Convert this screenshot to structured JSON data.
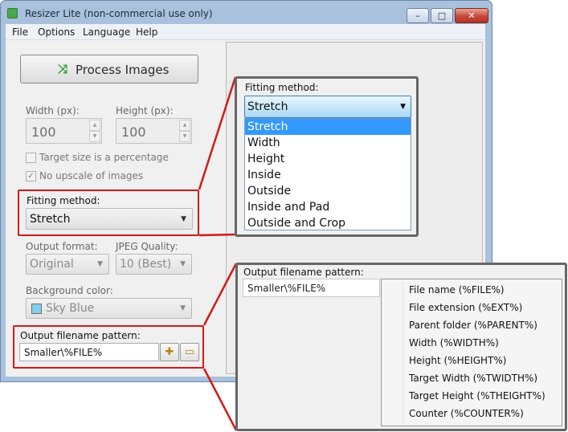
{
  "window": {
    "title": "Resizer Lite (non-commercial use only)",
    "minimize_glyph": "–",
    "maximize_glyph": "□",
    "close_glyph": "✕"
  },
  "menu": [
    "File",
    "Options",
    "Language",
    "Help"
  ],
  "process_button": {
    "label": "Process Images",
    "icon": "process-arrows-icon"
  },
  "width": {
    "label": "Width (px):",
    "value": "100"
  },
  "height": {
    "label": "Height (px):",
    "value": "100"
  },
  "checks": {
    "percentage": {
      "label": "Target size is a percentage",
      "checked": false
    },
    "no_upscale": {
      "label": "No upscale of images",
      "checked": true
    }
  },
  "fitting": {
    "label": "Fitting method:",
    "value": "Stretch"
  },
  "output_format": {
    "label": "Output format:",
    "value": "Original"
  },
  "jpeg_quality": {
    "label": "JPEG Quality:",
    "value": "10 (Best)"
  },
  "background": {
    "label": "Background color:",
    "value": "Sky Blue",
    "swatch_color": "#87ceeb"
  },
  "filename": {
    "label": "Output filename pattern:",
    "value": "Smaller\\%FILE%"
  },
  "fitting_zoom": {
    "label": "Fitting method:",
    "value": "Stretch",
    "options": [
      "Stretch",
      "Width",
      "Height",
      "Inside",
      "Outside",
      "Inside and Pad",
      "Outside and Crop"
    ],
    "selected_index": 0
  },
  "filename_zoom": {
    "label": "Output filename pattern:",
    "value": "Smaller\\%FILE%",
    "tokens": [
      "File name (%FILE%)",
      "File extension (%EXT%)",
      "Parent folder (%PARENT%)",
      "Width (%WIDTH%)",
      "Height (%HEIGHT%)",
      "Target Width (%TWIDTH%)",
      "Target Height (%THEIGHT%)",
      "Counter (%COUNTER%)"
    ]
  },
  "colors": {
    "highlight": "#d31919",
    "selection": "#3399ff",
    "callout_border": "#666666"
  }
}
